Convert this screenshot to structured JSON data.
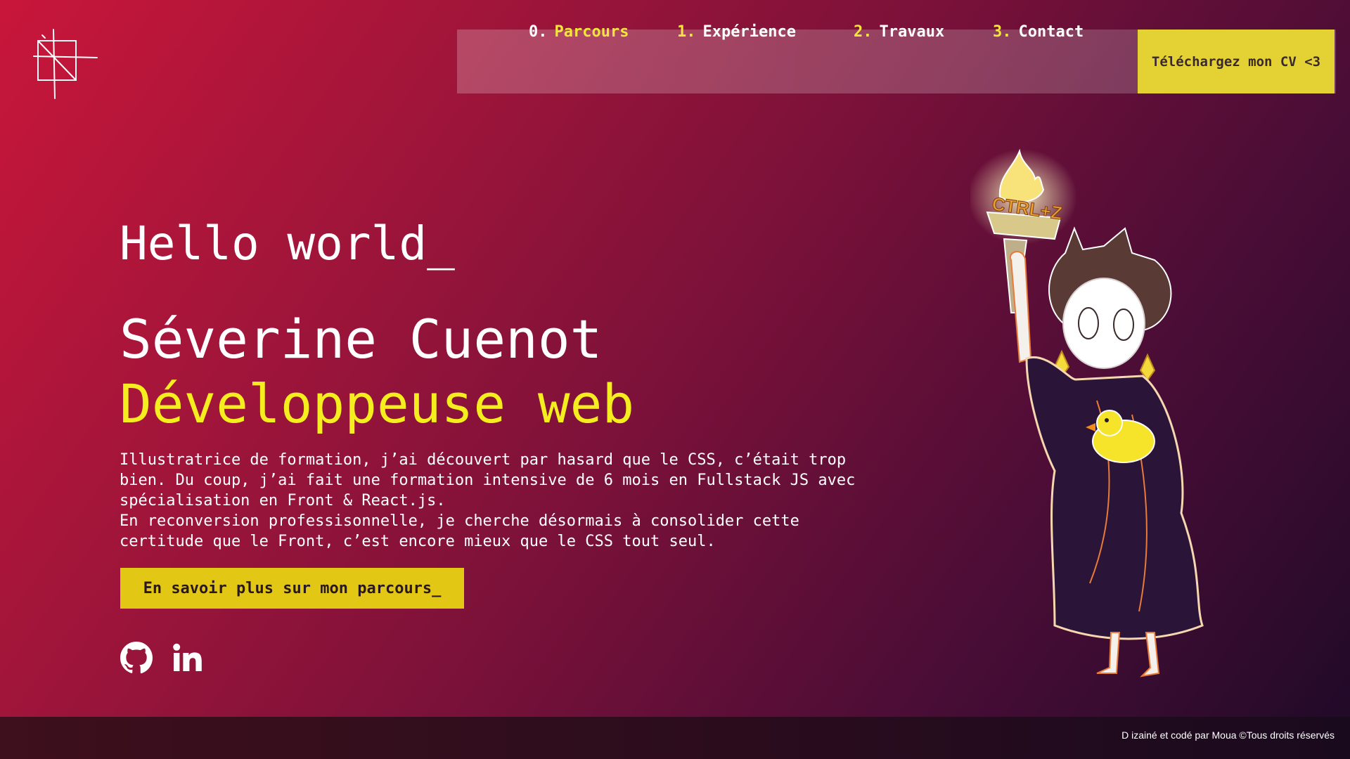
{
  "nav": {
    "items": [
      {
        "num": "0.",
        "label": "Parcours"
      },
      {
        "num": "1.",
        "label": "Expérience"
      },
      {
        "num": "2.",
        "label": "Travaux"
      },
      {
        "num": "3.",
        "label": "Contact"
      }
    ],
    "cv_label": "Téléchargez mon CV <3"
  },
  "hero": {
    "greeting": "Hello world_",
    "name": "Séverine Cuenot",
    "role": "Développeuse web",
    "bio_lines": [
      "Illustratrice de formation, j’ai découvert par hasard que le CSS, c’était trop",
      "bien. Du coup, j’ai fait une formation intensive de 6 mois en Fullstack JS avec",
      "spécialisation en Front & React.js.",
      "En reconversion professisonnelle, je cherche désormais à consolider cette",
      "certitude que le Front, c’est encore mieux que le CSS tout seul."
    ],
    "cta_label": "En savoir plus sur mon parcours_"
  },
  "social": {
    "github_icon": "github-icon",
    "linkedin_icon": "linkedin-icon"
  },
  "illustration": {
    "torch_text": "CTRL+Z"
  },
  "footer": {
    "credit": "D izainé et codé par Moua ©Tous droits réservés"
  },
  "colors": {
    "accent_yellow": "#f5ee1e",
    "button_yellow": "#e2c714",
    "cv_yellow": "#e4d234",
    "bg_start": "#c8163a",
    "bg_end": "#1f0a28"
  }
}
